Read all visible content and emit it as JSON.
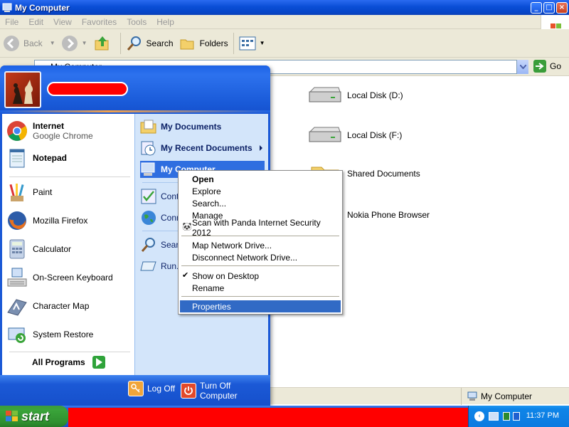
{
  "window": {
    "title": "My Computer",
    "controls": [
      "_",
      "□",
      "×"
    ]
  },
  "menubar": [
    "File",
    "Edit",
    "View",
    "Favorites",
    "Tools",
    "Help"
  ],
  "toolbar": {
    "back": "Back",
    "search": "Search",
    "folders": "Folders"
  },
  "address": {
    "value": "My Computer",
    "go": "Go"
  },
  "drives": [
    {
      "label": "Local Disk (D:)",
      "icon": "hard-drive-icon"
    },
    {
      "label": "Local Disk (F:)",
      "icon": "hard-drive-icon"
    },
    {
      "label": "Shared Documents",
      "icon": "folder-icon"
    },
    {
      "label": "Nokia Phone Browser",
      "icon": "phone-icon"
    }
  ],
  "status": {
    "location": "My Computer"
  },
  "startmenu": {
    "pinned": [
      {
        "title": "Internet",
        "subtitle": "Google Chrome"
      },
      {
        "title": "Notepad"
      }
    ],
    "recent": [
      "Paint",
      "Mozilla Firefox",
      "Calculator",
      "On-Screen Keyboard",
      "Character Map",
      "System Restore"
    ],
    "all_programs": "All Programs",
    "right": {
      "my_documents": "My Documents",
      "my_recent_documents": "My Recent Documents",
      "my_computer": "My Computer",
      "control_panel": "Contr",
      "connect_to": "Conn",
      "search": "Searc",
      "run": "Run..."
    },
    "log_off": "Log Off",
    "turn_off": "Turn Off Computer"
  },
  "context_menu": {
    "items": [
      "Open",
      "Explore",
      "Search...",
      "Manage",
      "Scan with Panda Internet Security 2012",
      "Map Network Drive...",
      "Disconnect Network Drive...",
      "Show on Desktop",
      "Rename",
      "Properties"
    ]
  },
  "taskbar": {
    "start": "start",
    "clock": "11:37 PM"
  }
}
